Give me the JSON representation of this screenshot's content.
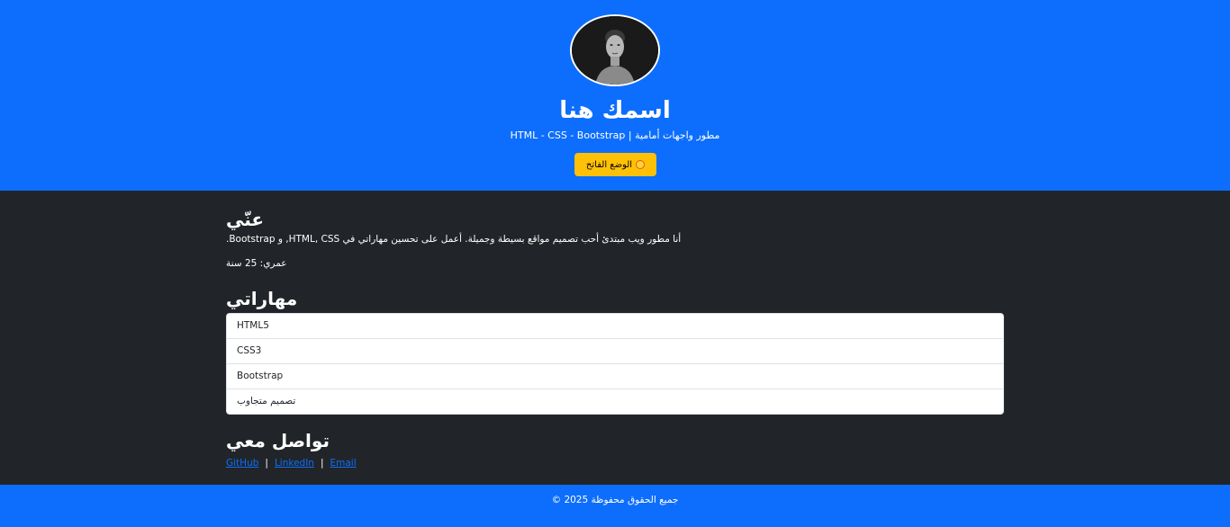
{
  "header": {
    "name": "اسمك هنا",
    "subtitle": "مطور واجهات أمامية | HTML - CSS - Bootstrap",
    "theme_button_label": "الوضع الفاتح",
    "theme_button_icon": "sun-icon"
  },
  "about": {
    "title": "عنّي",
    "text": "أنا مطور ويب مبتدئ أحب تصميم مواقع بسيطة وجميلة. أعمل على تحسين مهاراتي في HTML, CSS, و Bootstrap.",
    "age": "عمري: 25 سنة"
  },
  "skills": {
    "title": "مهاراتي",
    "items": [
      "HTML5",
      "CSS3",
      "Bootstrap",
      "تصميم متجاوب"
    ]
  },
  "contact": {
    "title": "تواصل معي",
    "links": [
      "GitHub",
      "LinkedIn",
      "Email"
    ],
    "separator": "|"
  },
  "footer": {
    "text": "جميع الحقوق محفوظة 2025 ©"
  },
  "colors": {
    "primary": "#0d6efd",
    "dark": "#212529",
    "warning": "#ffc107"
  }
}
